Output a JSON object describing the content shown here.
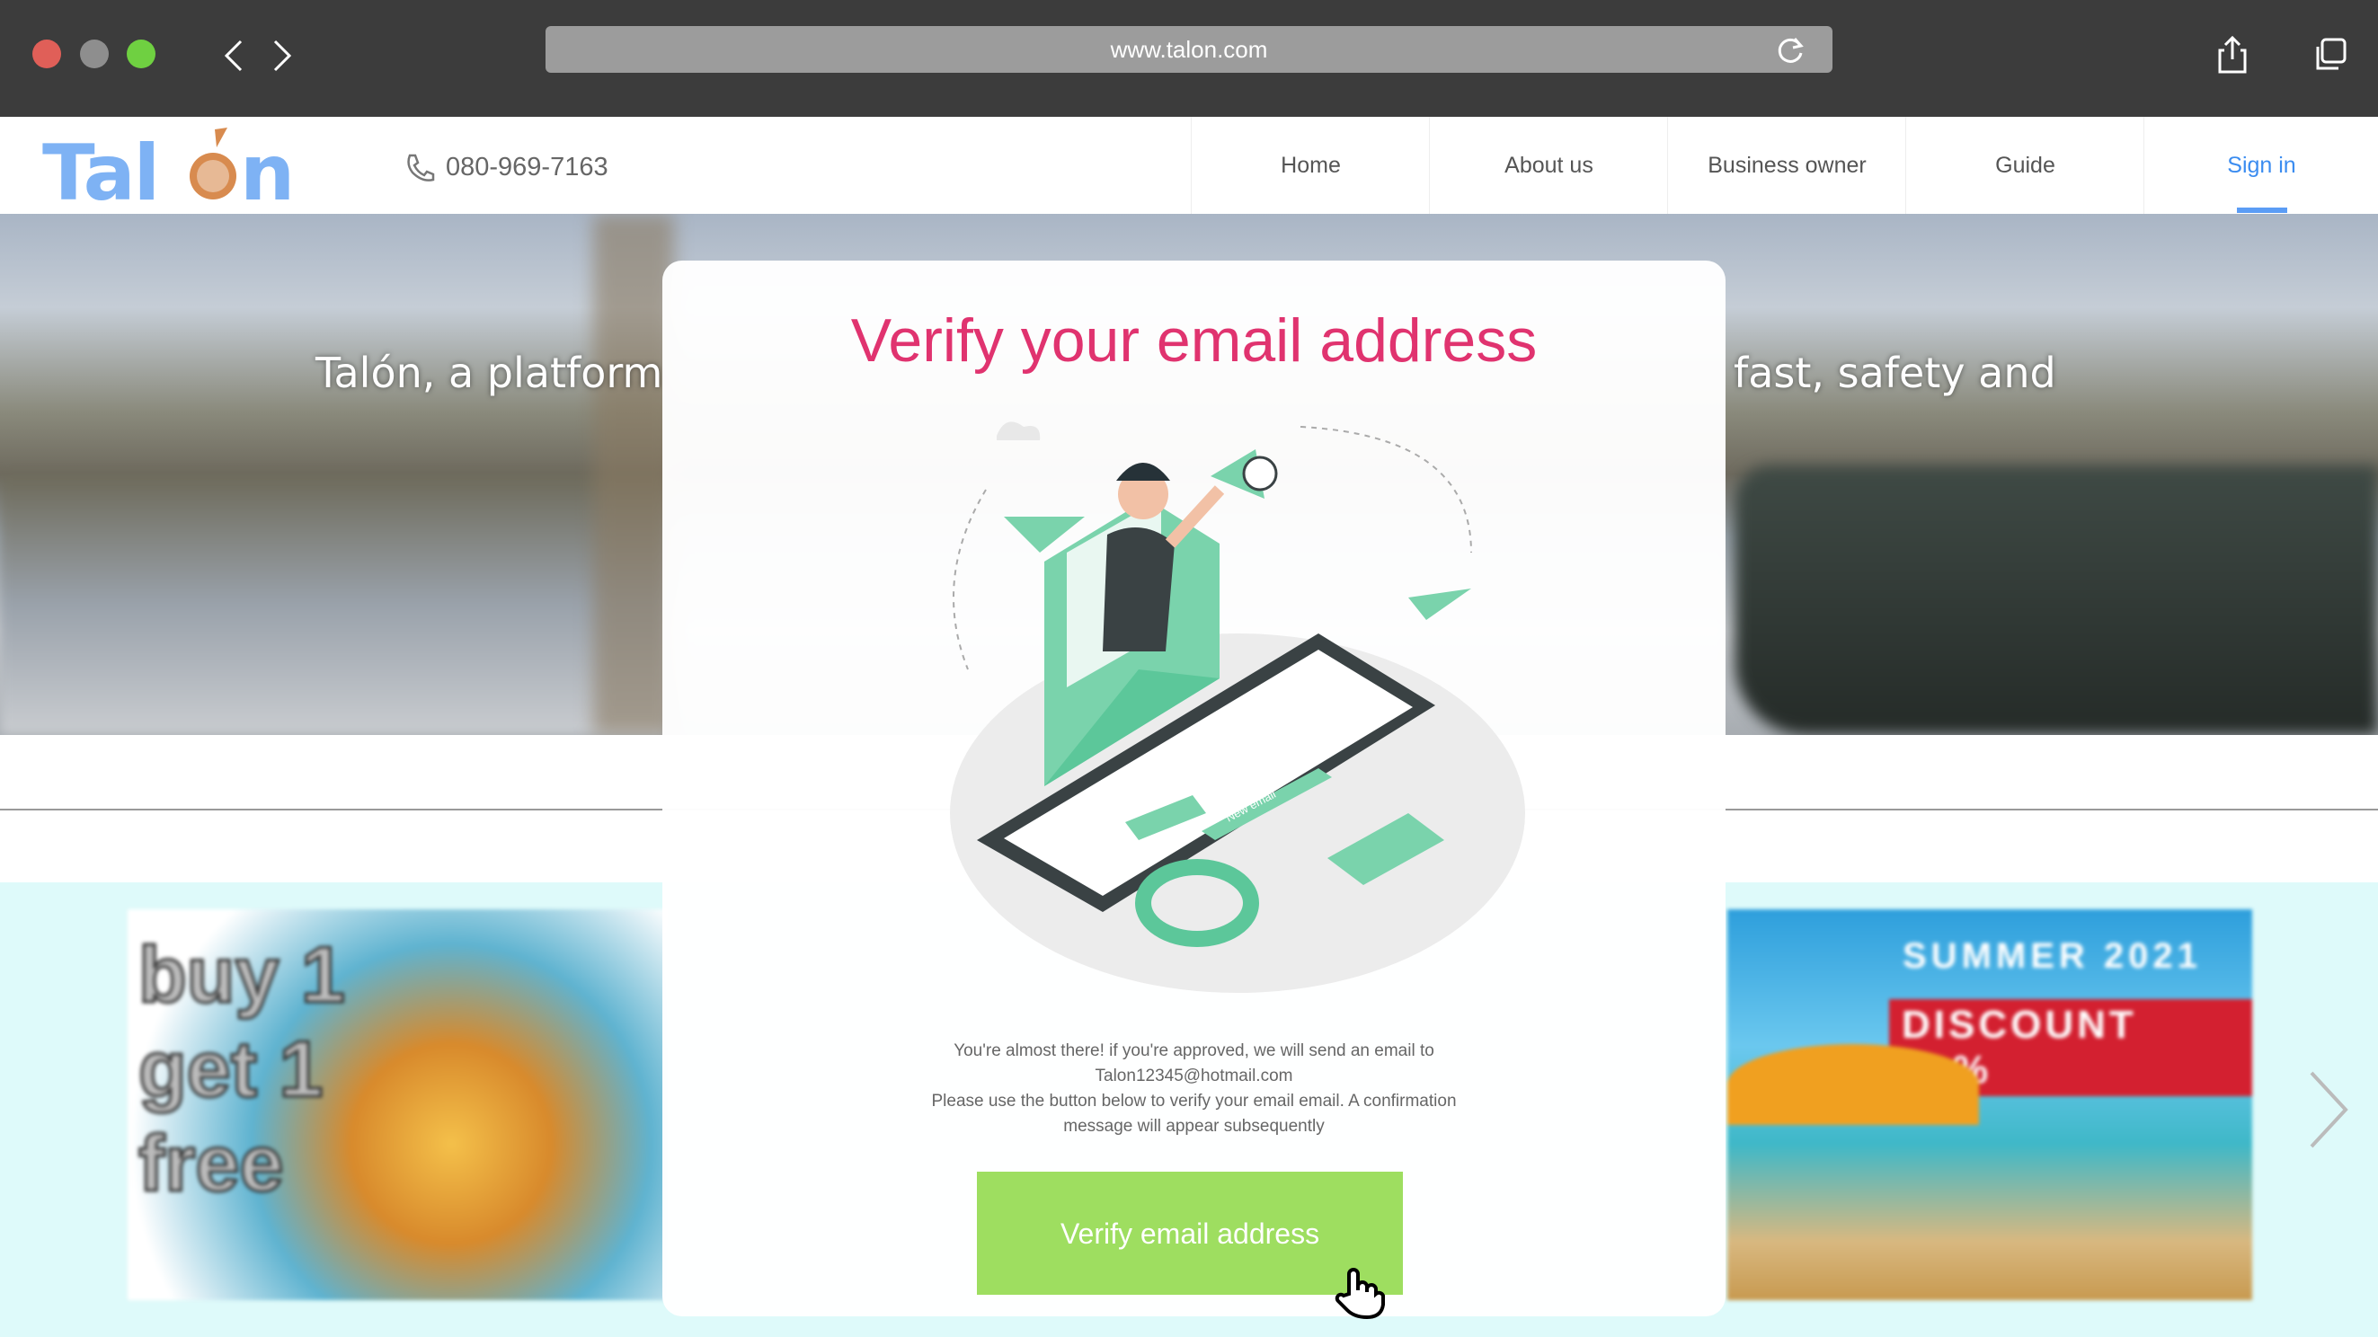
{
  "browser": {
    "url": "www.talon.com",
    "icons": [
      "close-icon",
      "minimize-icon",
      "fullscreen-icon",
      "back-icon",
      "forward-icon",
      "reload-icon",
      "share-icon",
      "tabs-icon"
    ]
  },
  "header": {
    "logo": "Talón",
    "phone": "080-969-7163",
    "nav": [
      {
        "label": "Home"
      },
      {
        "label": "About us"
      },
      {
        "label": "Business owner"
      },
      {
        "label": "Guide"
      },
      {
        "label": "Sign in",
        "active": true
      }
    ]
  },
  "hero": {
    "text_left": "Talón, a platform",
    "text_right": "fast, safety and"
  },
  "promo": {
    "left_banner": "buy 1 get 1 free",
    "right_banner_line1": "SUMMER 2021",
    "right_banner_line2": "DISCOUNT 50%"
  },
  "modal": {
    "title": "Verify your email address",
    "illustration_label": "New email",
    "line1": "You're almost there! if you're approved, we will send an email to",
    "email": "Talon12345@hotmail.com",
    "line2": "Please use the button below to verify your email email. A confirmation",
    "line3": "message will appear subsequently",
    "button": "Verify email address"
  },
  "colors": {
    "accent": "#e0336f",
    "button": "#9ede60",
    "link": "#3b8cf0",
    "promo_bg": "#defafa"
  }
}
